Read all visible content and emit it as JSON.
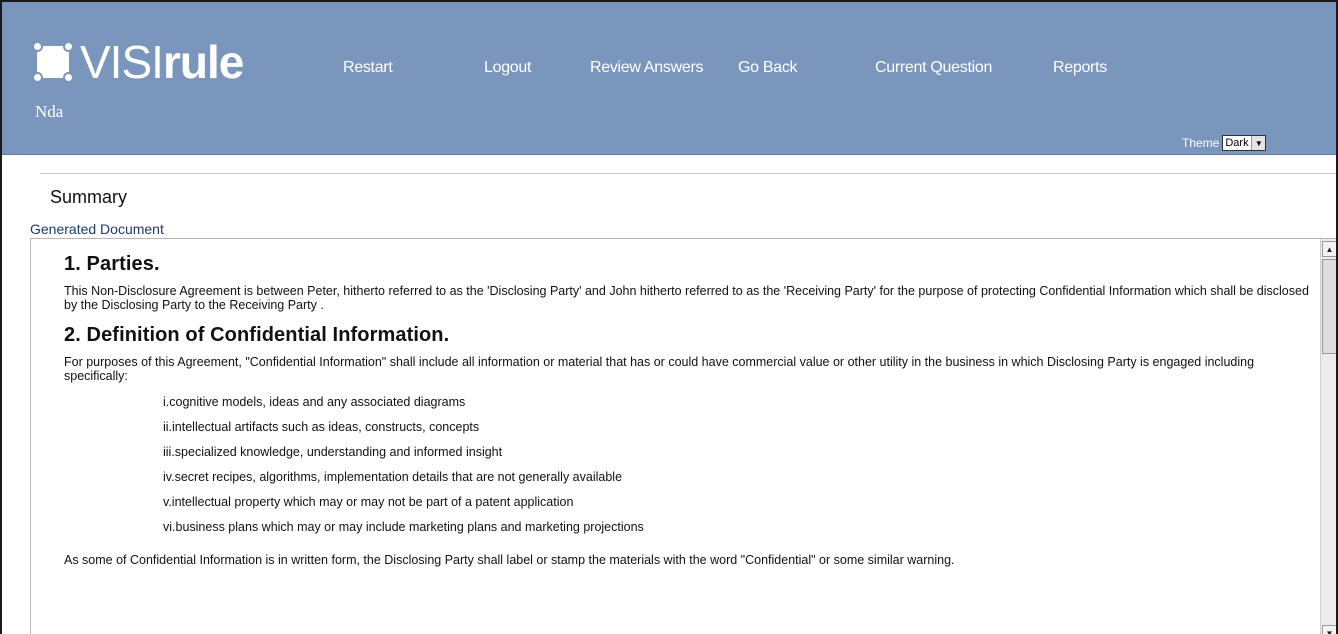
{
  "header": {
    "logo_text_thin": "VISI",
    "logo_text_bold": "rule",
    "app_name": "Nda",
    "nav": [
      {
        "label": "Restart"
      },
      {
        "label": "Logout"
      },
      {
        "label": "Review Answers"
      },
      {
        "label": "Go Back"
      },
      {
        "label": "Current Question"
      },
      {
        "label": "Reports"
      }
    ],
    "theme_label": "Theme",
    "theme_value": "Dark",
    "background_color": "#7a96bd"
  },
  "summary": {
    "title": "Summary",
    "generated_label": "Generated Document"
  },
  "document": {
    "section1_heading": "1. Parties.",
    "section1_text": "This Non-Disclosure Agreement is between Peter, hitherto referred to as the 'Disclosing Party' and John hitherto referred to as the 'Receiving Party' for the purpose of protecting Confidential Information which shall be disclosed by the Disclosing Party to the Receiving Party .",
    "section2_heading": "2. Definition of Confidential Information.",
    "section2_intro": "For purposes of this Agreement, \"Confidential Information\" shall include all information or material that has or could have commercial value or other utility in the business in which Disclosing Party is engaged including specifically:",
    "items": [
      "i.cognitive models, ideas and any associated diagrams",
      "ii.intellectual artifacts such as ideas, constructs, concepts",
      "iii.specialized knowledge, understanding and informed insight",
      "iv.secret recipes, algorithms, implementation details that are not generally available",
      "v.intellectual property which may or may not be part of a patent application",
      "vi.business plans which may or may include marketing plans and marketing projections"
    ],
    "section2_closing": "As some of Confidential Information is in written form, the Disclosing Party shall label or stamp the materials with the word \"Confidential\" or some similar warning."
  }
}
